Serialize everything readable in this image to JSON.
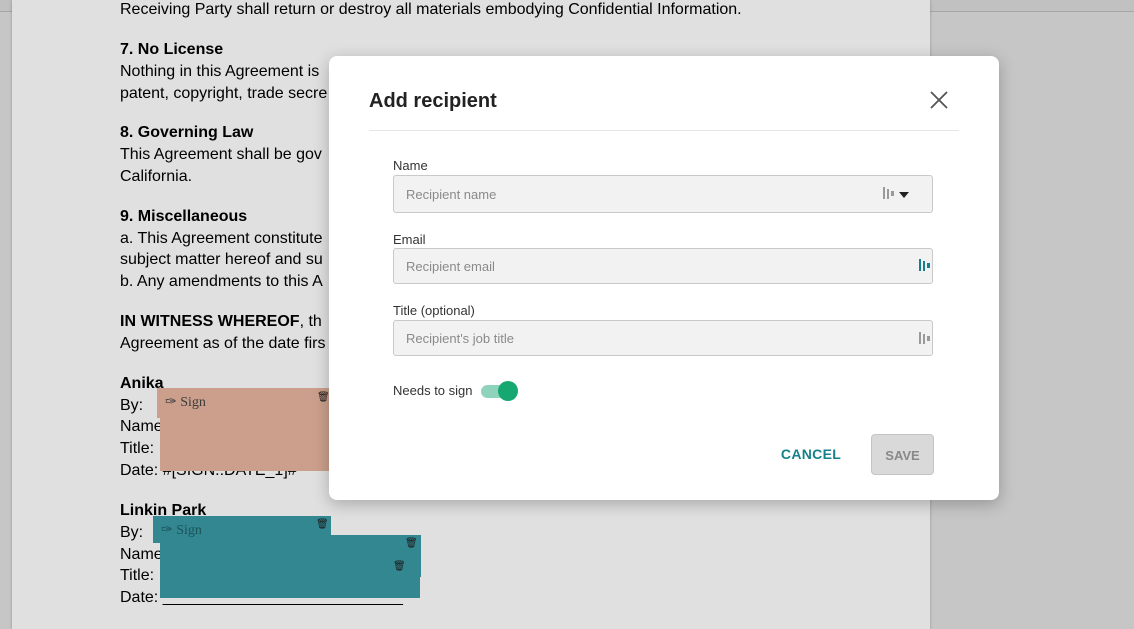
{
  "document": {
    "lines": [
      "Receiving Party shall return or destroy all materials embodying Confidential Information.",
      "7. No License",
      "Nothing in this Agreement is",
      "patent, copyright, trade secre",
      "8. Governing Law",
      "This Agreement shall be gov",
      "California.",
      "9. Miscellaneous",
      "a. This Agreement constitute",
      "subject matter hereof and su",
      "b. Any amendments to this A",
      "IN WITNESS WHEREOF",
      ", th",
      "Agreement as of the date firs",
      "Anika",
      "By:",
      "Name:",
      "Title:",
      "Date: #[SIGN::DATE_1]#",
      "Linkin Park",
      "By:",
      "Name:",
      "Title:",
      "Date: ___________________________"
    ],
    "sign_field_label": "Sign",
    "sign_icon": "pen-icon",
    "trash_icon": "trash-icon",
    "colors": {
      "signer1": "#e8b5a0",
      "signer2": "#3a9aa5"
    }
  },
  "modal": {
    "title": "Add recipient",
    "close_icon": "close-icon",
    "name_label": "Name",
    "name_placeholder": "Recipient name",
    "email_label": "Email",
    "email_placeholder": "Recipient email",
    "title_label": "Title (optional)",
    "title_placeholder": "Recipient's job title",
    "input_icon": "contacts-icon",
    "dropdown_icon": "caret-down-icon",
    "needs_to_sign_label": "Needs to sign",
    "needs_to_sign": true,
    "cancel_label": "CANCEL",
    "save_label": "SAVE",
    "accent_color": "#16818a",
    "toggle_color": "#16a870"
  }
}
